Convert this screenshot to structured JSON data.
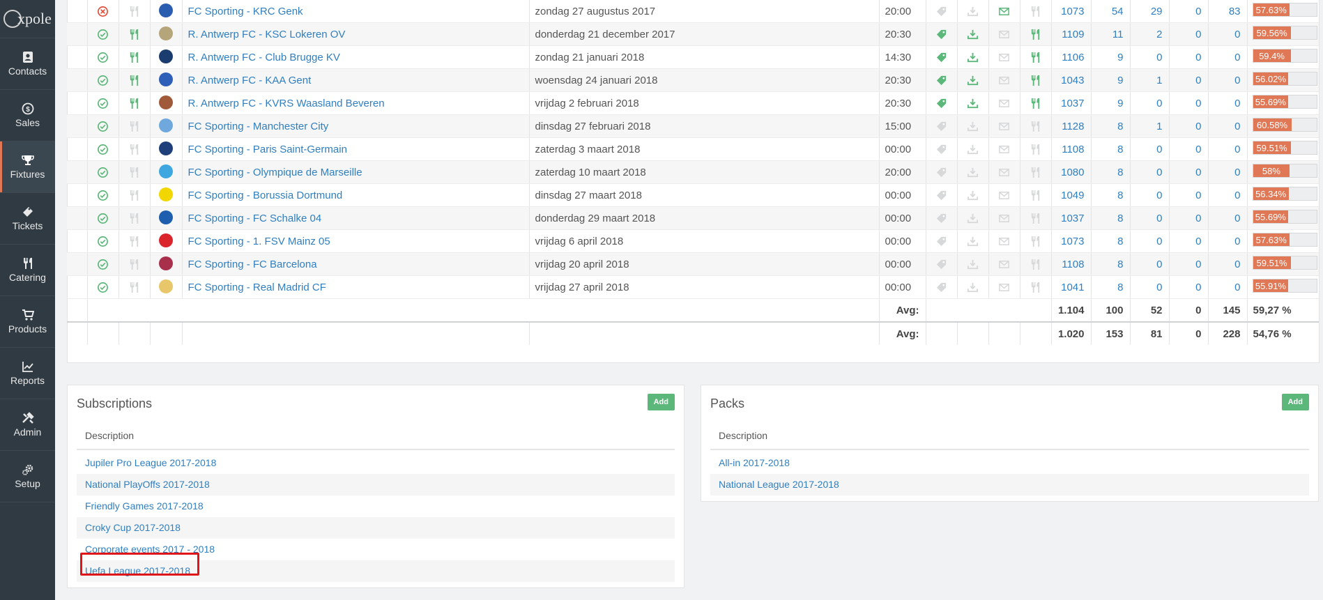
{
  "app": {
    "logo_text": "xpole"
  },
  "nav": [
    {
      "label": "Contacts",
      "icon": "contacts-icon"
    },
    {
      "label": "Sales",
      "icon": "dollar-icon"
    },
    {
      "label": "Fixtures",
      "icon": "trophy-icon",
      "active": true
    },
    {
      "label": "Tickets",
      "icon": "ticket-icon"
    },
    {
      "label": "Catering",
      "icon": "cutlery-icon"
    },
    {
      "label": "Products",
      "icon": "cart-icon"
    },
    {
      "label": "Reports",
      "icon": "line-chart-icon"
    },
    {
      "label": "Admin",
      "icon": "tools-icon"
    },
    {
      "label": "Setup",
      "icon": "gears-icon"
    }
  ],
  "colors": {
    "accent": "#e07856",
    "link": "#2f7fc0",
    "green": "#5cb87a",
    "red": "#e0151a",
    "sidebar": "#2f3a42"
  },
  "fixtures": [
    {
      "status": "cancelled",
      "catering": false,
      "crest": "#2a5db0",
      "match": "FC Sporting - KRC Genk",
      "date": "zondag 27 augustus 2017",
      "time": "20:00",
      "tag": false,
      "dl": false,
      "mail": true,
      "food": false,
      "cap": "1073",
      "a": "54",
      "b": "29",
      "c": "0",
      "d": "83",
      "pct": "57.63%",
      "pct_value": 57.63
    },
    {
      "status": "ok",
      "catering": true,
      "crest": "#b5a57a",
      "match": "R. Antwerp FC - KSC Lokeren OV",
      "date": "donderdag 21 december 2017",
      "time": "20:30",
      "tag": true,
      "dl": true,
      "mail": false,
      "food": true,
      "cap": "1109",
      "a": "11",
      "b": "2",
      "c": "0",
      "d": "0",
      "pct": "59.56%",
      "pct_value": 59.56
    },
    {
      "status": "ok",
      "catering": true,
      "crest": "#1b3c6e",
      "match": "R. Antwerp FC - Club Brugge KV",
      "date": "zondag 21 januari 2018",
      "time": "14:30",
      "tag": true,
      "dl": true,
      "mail": false,
      "food": true,
      "cap": "1106",
      "a": "9",
      "b": "0",
      "c": "0",
      "d": "0",
      "pct": "59.4%",
      "pct_value": 59.4
    },
    {
      "status": "ok",
      "catering": true,
      "crest": "#2d5fb8",
      "match": "R. Antwerp FC - KAA Gent",
      "date": "woensdag 24 januari 2018",
      "time": "20:30",
      "tag": true,
      "dl": true,
      "mail": false,
      "food": true,
      "cap": "1043",
      "a": "9",
      "b": "1",
      "c": "0",
      "d": "0",
      "pct": "56.02%",
      "pct_value": 56.02
    },
    {
      "status": "ok",
      "catering": true,
      "crest": "#a05a3a",
      "match": "R. Antwerp FC - KVRS Waasland Beveren",
      "date": "vrijdag 2 februari 2018",
      "time": "20:30",
      "tag": true,
      "dl": true,
      "mail": false,
      "food": true,
      "cap": "1037",
      "a": "9",
      "b": "0",
      "c": "0",
      "d": "0",
      "pct": "55.69%",
      "pct_value": 55.69
    },
    {
      "status": "ok",
      "catering": false,
      "crest": "#6fa8dc",
      "match": "FC Sporting - Manchester City",
      "date": "dinsdag 27 februari 2018",
      "time": "15:00",
      "tag": false,
      "dl": false,
      "mail": false,
      "food": false,
      "cap": "1128",
      "a": "8",
      "b": "1",
      "c": "0",
      "d": "0",
      "pct": "60.58%",
      "pct_value": 60.58
    },
    {
      "status": "ok",
      "catering": false,
      "crest": "#1f3f7a",
      "match": "FC Sporting - Paris Saint-Germain",
      "date": "zaterdag 3 maart 2018",
      "time": "00:00",
      "tag": false,
      "dl": false,
      "mail": false,
      "food": false,
      "cap": "1108",
      "a": "8",
      "b": "0",
      "c": "0",
      "d": "0",
      "pct": "59.51%",
      "pct_value": 59.51
    },
    {
      "status": "ok",
      "catering": false,
      "crest": "#3fa7e0",
      "match": "FC Sporting - Olympique de Marseille",
      "date": "zaterdag 10 maart 2018",
      "time": "20:00",
      "tag": false,
      "dl": false,
      "mail": false,
      "food": false,
      "cap": "1080",
      "a": "8",
      "b": "0",
      "c": "0",
      "d": "0",
      "pct": "58%",
      "pct_value": 58
    },
    {
      "status": "ok",
      "catering": false,
      "crest": "#f2d600",
      "match": "FC Sporting - Borussia Dortmund",
      "date": "dinsdag 27 maart 2018",
      "time": "00:00",
      "tag": false,
      "dl": false,
      "mail": false,
      "food": false,
      "cap": "1049",
      "a": "8",
      "b": "0",
      "c": "0",
      "d": "0",
      "pct": "56.34%",
      "pct_value": 56.34
    },
    {
      "status": "ok",
      "catering": false,
      "crest": "#1d5fae",
      "match": "FC Sporting - FC Schalke 04",
      "date": "donderdag 29 maart 2018",
      "time": "00:00",
      "tag": false,
      "dl": false,
      "mail": false,
      "food": false,
      "cap": "1037",
      "a": "8",
      "b": "0",
      "c": "0",
      "d": "0",
      "pct": "55.69%",
      "pct_value": 55.69
    },
    {
      "status": "ok",
      "catering": false,
      "crest": "#d9252b",
      "match": "FC Sporting - 1. FSV Mainz 05",
      "date": "vrijdag 6 april 2018",
      "time": "00:00",
      "tag": false,
      "dl": false,
      "mail": false,
      "food": false,
      "cap": "1073",
      "a": "8",
      "b": "0",
      "c": "0",
      "d": "0",
      "pct": "57.63%",
      "pct_value": 57.63
    },
    {
      "status": "ok",
      "catering": false,
      "crest": "#a8304a",
      "match": "FC Sporting - FC Barcelona",
      "date": "vrijdag 20 april 2018",
      "time": "00:00",
      "tag": false,
      "dl": false,
      "mail": false,
      "food": false,
      "cap": "1108",
      "a": "8",
      "b": "0",
      "c": "0",
      "d": "0",
      "pct": "59.51%",
      "pct_value": 59.51
    },
    {
      "status": "ok",
      "catering": false,
      "crest": "#e8c66a",
      "match": "FC Sporting - Real Madrid CF",
      "date": "vrijdag 27 april 2018",
      "time": "00:00",
      "tag": false,
      "dl": false,
      "mail": false,
      "food": false,
      "cap": "1041",
      "a": "8",
      "b": "0",
      "c": "0",
      "d": "0",
      "pct": "55.91%",
      "pct_value": 55.91
    }
  ],
  "averages": [
    {
      "label": "Avg:",
      "cap": "1.104",
      "a": "100",
      "b": "52",
      "c": "0",
      "d": "145",
      "pct": "59,27 %"
    },
    {
      "label": "Avg:",
      "cap": "1.020",
      "a": "153",
      "b": "81",
      "c": "0",
      "d": "228",
      "pct": "54,76 %"
    }
  ],
  "subscriptions": {
    "title": "Subscriptions",
    "add_label": "Add",
    "column": "Description",
    "items": [
      "Jupiler Pro League 2017-2018",
      "National PlayOffs 2017-2018",
      "Friendly Games 2017-2018",
      "Croky Cup 2017-2018",
      "Corporate events 2017 - 2018",
      "Uefa League 2017-2018"
    ]
  },
  "packs": {
    "title": "Packs",
    "add_label": "Add",
    "column": "Description",
    "items": [
      "All-in 2017-2018",
      "National League 2017-2018"
    ]
  }
}
